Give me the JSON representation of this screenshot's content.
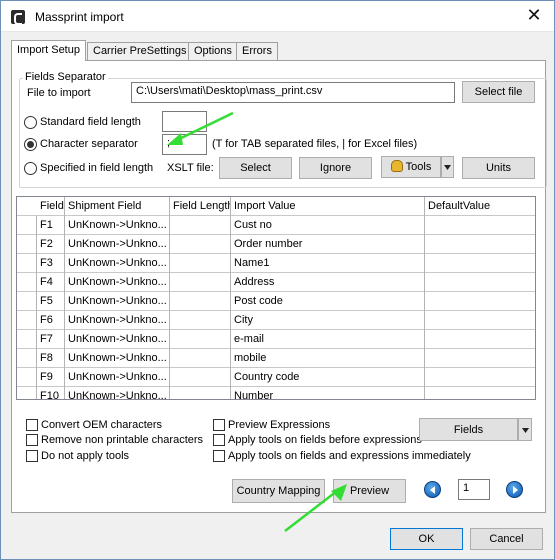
{
  "window": {
    "title": "Massprint import",
    "close_glyph": "✕"
  },
  "tabs": [
    {
      "label": "Import Setup",
      "active": true
    },
    {
      "label": "Carrier PreSettings",
      "active": false
    },
    {
      "label": "Options",
      "active": false
    },
    {
      "label": "Errors",
      "active": false
    }
  ],
  "fields_separator": {
    "group_label": "Fields Separator",
    "file_label": "File to import",
    "file_value": "C:\\Users\\mati\\Desktop\\mass_print.csv",
    "select_file_label": "Select file",
    "standard_length_label": "Standard field length",
    "standard_length_value": "",
    "character_separator_label": "Character separator",
    "character_separator_value": ";",
    "separator_hint": "(T for TAB separated files, | for Excel files)",
    "specified_length_label": "Specified in field length",
    "xslt_label": "XSLT file:",
    "select_label": "Select",
    "ignore_label": "Ignore",
    "tools_label": "Tools",
    "units_label": "Units",
    "selected_mode": "character_separator"
  },
  "grid": {
    "columns": [
      "Field",
      "Shipment Field",
      "Field Length",
      "Import Value",
      "DefaultValue"
    ],
    "rows": [
      {
        "field": "F1",
        "shipment": "UnKnown->Unkno...",
        "length": "",
        "import": "Cust no",
        "default": ""
      },
      {
        "field": "F2",
        "shipment": "UnKnown->Unkno...",
        "length": "",
        "import": "Order number",
        "default": ""
      },
      {
        "field": "F3",
        "shipment": "UnKnown->Unkno...",
        "length": "",
        "import": "Name1",
        "default": ""
      },
      {
        "field": "F4",
        "shipment": "UnKnown->Unkno...",
        "length": "",
        "import": "Address",
        "default": ""
      },
      {
        "field": "F5",
        "shipment": "UnKnown->Unkno...",
        "length": "",
        "import": "Post code",
        "default": ""
      },
      {
        "field": "F6",
        "shipment": "UnKnown->Unkno...",
        "length": "",
        "import": "City",
        "default": ""
      },
      {
        "field": "F7",
        "shipment": "UnKnown->Unkno...",
        "length": "",
        "import": "e-mail",
        "default": ""
      },
      {
        "field": "F8",
        "shipment": "UnKnown->Unkno...",
        "length": "",
        "import": "mobile",
        "default": ""
      },
      {
        "field": "F9",
        "shipment": "UnKnown->Unkno...",
        "length": "",
        "import": "Country code",
        "default": ""
      },
      {
        "field": "F10",
        "shipment": "UnKnown->Unkno...",
        "length": "",
        "import": "Number",
        "default": ""
      }
    ]
  },
  "options": {
    "convert_oem": {
      "label": "Convert OEM characters",
      "checked": false
    },
    "remove_non_printable": {
      "label": "Remove non printable characters",
      "checked": false
    },
    "no_tools": {
      "label": "Do not apply tools",
      "checked": false
    },
    "preview_expressions": {
      "label": "Preview Expressions",
      "checked": false
    },
    "tools_before": {
      "label": "Apply tools on fields before expressions",
      "checked": false
    },
    "tools_immediately": {
      "label": "Apply tools on fields and expressions immediately",
      "checked": false
    },
    "fields_label": "Fields"
  },
  "actions": {
    "country_mapping_label": "Country Mapping",
    "preview_label": "Preview",
    "page_value": "1",
    "ok_label": "OK",
    "cancel_label": "Cancel"
  },
  "colors": {
    "annotation_arrow": "#33dd33",
    "focus_border": "#0078d7"
  }
}
